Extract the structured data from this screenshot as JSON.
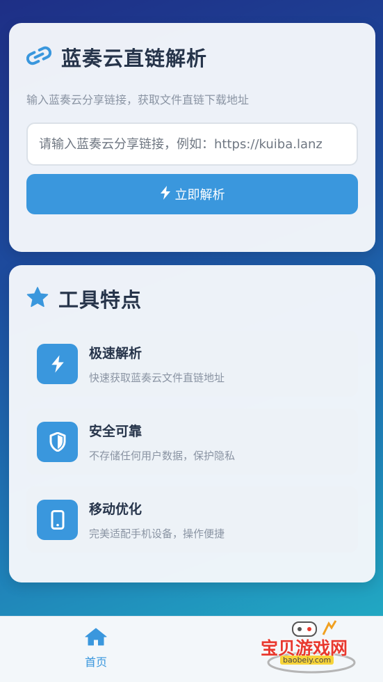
{
  "parser": {
    "title": "蓝奏云直链解析",
    "subtitle": "输入蓝奏云分享链接，获取文件直链下载地址",
    "input_placeholder": "请输入蓝奏云分享链接，例如：https://kuiba.lanz",
    "input_value": "",
    "button_label": "立即解析",
    "title_icon": "link-icon",
    "button_icon": "bolt-icon"
  },
  "features": {
    "title": "工具特点",
    "title_icon": "star-icon",
    "items": [
      {
        "title": "极速解析",
        "desc": "快速获取蓝奏云文件直链地址",
        "icon": "bolt-icon"
      },
      {
        "title": "安全可靠",
        "desc": "不存储任何用户数据，保护隐私",
        "icon": "shield-icon"
      },
      {
        "title": "移动优化",
        "desc": "完美适配手机设备，操作便捷",
        "icon": "mobile-icon"
      }
    ]
  },
  "nav": {
    "items": [
      {
        "label": "首页",
        "icon": "home-icon",
        "active": true
      }
    ]
  },
  "watermark": {
    "text": "宝贝游戏网",
    "url": "baobeiy.com"
  },
  "colors": {
    "accent": "#3a97dd",
    "title_text": "#26344a",
    "muted_text": "#8a94a3",
    "watermark": "#e8382e"
  }
}
